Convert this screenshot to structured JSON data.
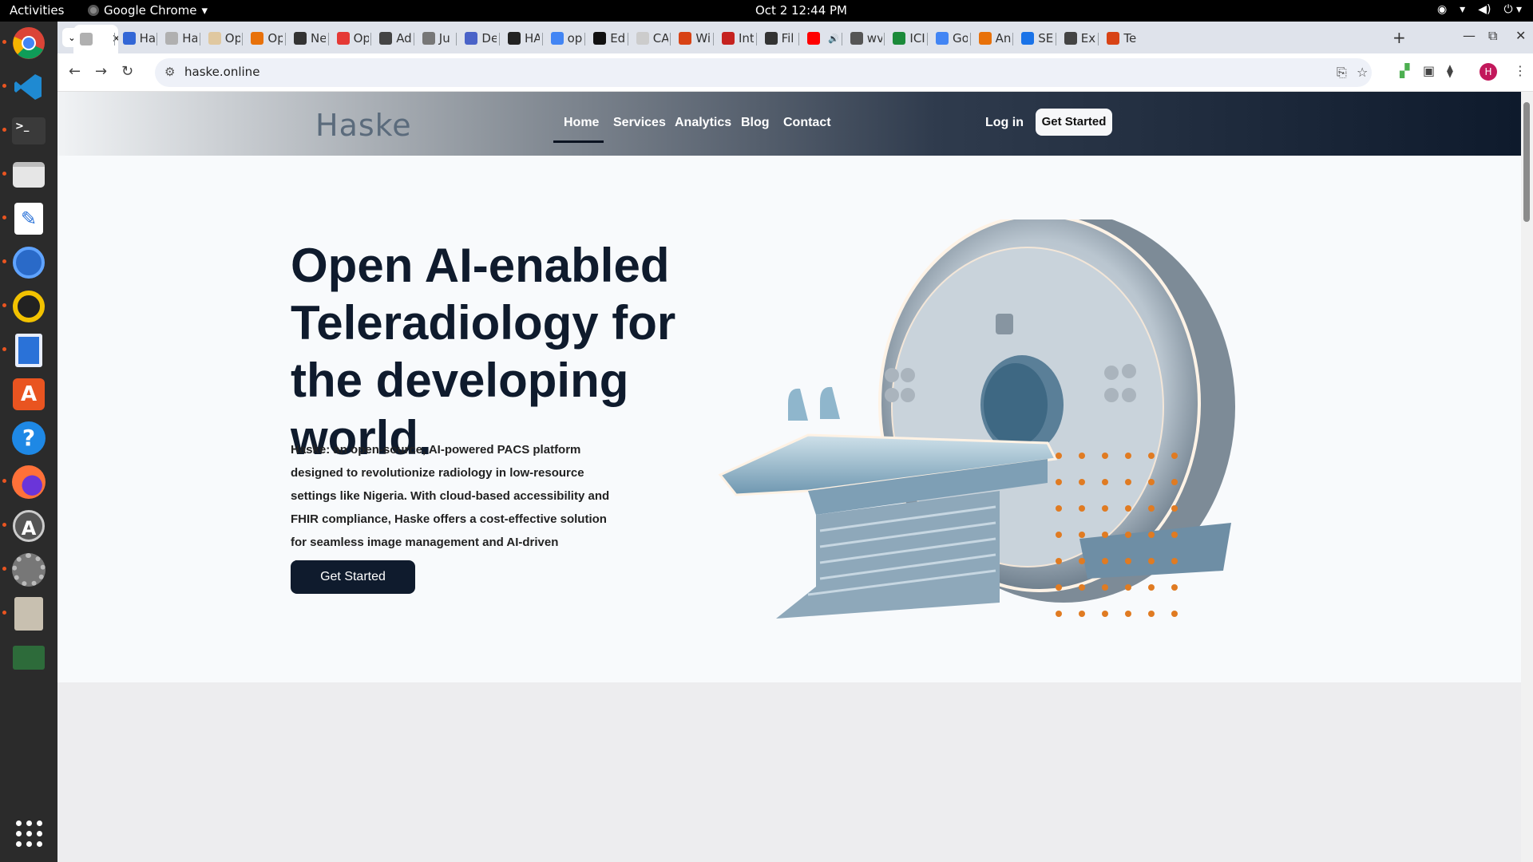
{
  "topbar": {
    "activities": "Activities",
    "app_name": "Google Chrome",
    "app_caret": "▾",
    "clock": "Oct 2  12:44 PM",
    "tray_icons": [
      "chrome-icon",
      "wifi-icon",
      "volume-icon",
      "power-icon"
    ]
  },
  "dock": {
    "items": [
      "chrome",
      "vscode",
      "terminal",
      "files",
      "text-editor",
      "thunderbird",
      "rhythmbox",
      "writer",
      "software",
      "help",
      "firefox",
      "update",
      "settings",
      "archive",
      "monitor"
    ]
  },
  "browser": {
    "tabs": [
      {
        "label": "",
        "fav_color": "#b0b0b0",
        "active": true
      },
      {
        "label": "Ha",
        "fav_color": "#3367d6"
      },
      {
        "label": "Ha",
        "fav_color": "#b0b0b0"
      },
      {
        "label": "Op",
        "fav_color": "#e0c8a0"
      },
      {
        "label": "Op",
        "fav_color": "#e8710a"
      },
      {
        "label": "Ne",
        "fav_color": "#333333"
      },
      {
        "label": "Op",
        "fav_color": "#e53935"
      },
      {
        "label": "Ad",
        "fav_color": "#444444"
      },
      {
        "label": "Ju",
        "fav_color": "#777777"
      },
      {
        "label": "De",
        "fav_color": "#4a63c8"
      },
      {
        "label": "HA",
        "fav_color": "#222222"
      },
      {
        "label": "op",
        "fav_color": "#4285f4"
      },
      {
        "label": "Ed",
        "fav_color": "#111111"
      },
      {
        "label": "CA",
        "fav_color": "#cccccc"
      },
      {
        "label": "Wi",
        "fav_color": "#d84315"
      },
      {
        "label": "Int",
        "fav_color": "#c5221f"
      },
      {
        "label": "Fil",
        "fav_color": "#333333"
      },
      {
        "label": "",
        "fav_color": "#ff0000",
        "audio": true
      },
      {
        "label": "wv",
        "fav_color": "#555555"
      },
      {
        "label": "ICI",
        "fav_color": "#1b8a3a"
      },
      {
        "label": "Go",
        "fav_color": "#4285f4"
      },
      {
        "label": "An",
        "fav_color": "#e8710a"
      },
      {
        "label": "SE",
        "fav_color": "#1a73e8"
      },
      {
        "label": "Ex",
        "fav_color": "#444444"
      },
      {
        "label": "Te",
        "fav_color": "#d84315"
      }
    ],
    "new_tab": "+",
    "url": "haske.online",
    "profile_initial": "H"
  },
  "site": {
    "logo": "Haske",
    "nav": [
      "Home",
      "Services",
      "Analytics",
      "Blog",
      "Contact"
    ],
    "login": "Log in",
    "nav_cta": "Get Started",
    "hero_title": "Open AI-enabled Teleradiology for the developing world.",
    "hero_text": "Haske: an open-source, AI-powered PACS platform designed to revolutionize radiology in low-resource settings like Nigeria. With cloud-based accessibility and FHIR compliance, Haske offers a cost-effective solution for seamless image management and AI-driven diagnostics.",
    "hero_cta": "Get Started",
    "colors": {
      "navy": "#0f1b2d",
      "dots": "#e07b22"
    }
  }
}
